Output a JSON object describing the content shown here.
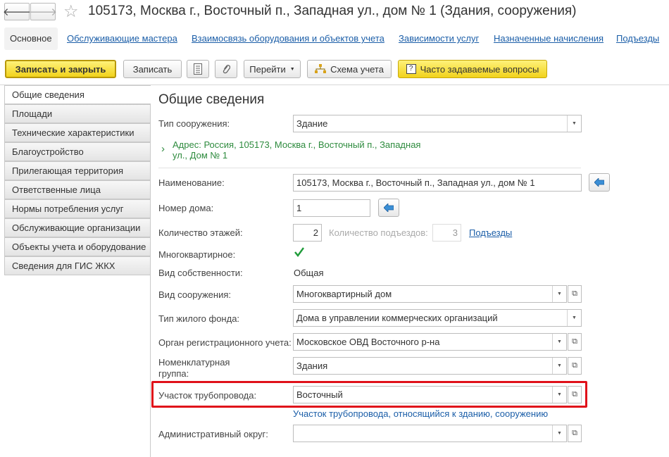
{
  "window": {
    "title": "105173, Москва г., Восточный п., Западная ул., дом № 1 (Здания, сооружения)"
  },
  "nav": {
    "back": "🡐",
    "forward": "🡒",
    "star": "☆"
  },
  "tabs": [
    "Основное",
    "Обслуживающие мастера",
    "Взаимосвязь оборудования и объектов учета",
    "Зависимости услуг",
    "Назначенные начисления",
    "Подъезды"
  ],
  "toolbar": {
    "save_close": "Записать и закрыть",
    "save": "Записать",
    "goto": "Перейти",
    "scheme": "Схема учета",
    "faq": "Часто задаваемые вопросы"
  },
  "sidebar": [
    "Общие сведения",
    "Площади",
    "Технические характеристики",
    "Благоустройство",
    "Прилегающая территория",
    "Ответственные лица",
    "Нормы потребления услуг",
    "Обслуживающие организации",
    "Объекты учета и оборудование",
    "Сведения для ГИС ЖКХ"
  ],
  "form": {
    "heading": "Общие сведения",
    "type_label": "Тип сооружения:",
    "type_value": "Здание",
    "address_line1": "Адрес: Россия, 105173, Москва г., Восточный п., Западная",
    "address_line2": "ул., Дом № 1",
    "name_label": "Наименование:",
    "name_value": "105173, Москва г., Восточный п., Западная ул., дом № 1",
    "house_label": "Номер дома:",
    "house_value": "1",
    "floors_label": "Количество этажей:",
    "floors_value": "2",
    "entrances_label": "Количество подъездов:",
    "entrances_value": "3",
    "entrances_link": "Подъезды",
    "apartment_label": "Многоквартирное:",
    "ownership_label": "Вид собственности:",
    "ownership_value": "Общая",
    "building_kind_label": "Вид сооружения:",
    "building_kind_value": "Многоквартирный дом",
    "housing_type_label": "Тип жилого фонда:",
    "housing_type_value": "Дома в управлении коммерческих организаций",
    "registry_label": "Орган регистрационного учета:",
    "registry_value": "Московское ОВД Восточного р-на",
    "nomenclature_label1": "Номенклатурная",
    "nomenclature_label2": "группа:",
    "nomenclature_value": "Здания",
    "pipeline_label": "Участок трубопровода:",
    "pipeline_value": "Восточный",
    "pipeline_hint": "Участок трубопровода, относящийся к зданию, сооружению",
    "district_label": "Административный округ:",
    "district_value": ""
  },
  "colors": {
    "accent_link": "#1b5ea8",
    "highlight": "#e0111a",
    "yellow_button": "#f1d21b",
    "address_green": "#2e8b3e"
  }
}
